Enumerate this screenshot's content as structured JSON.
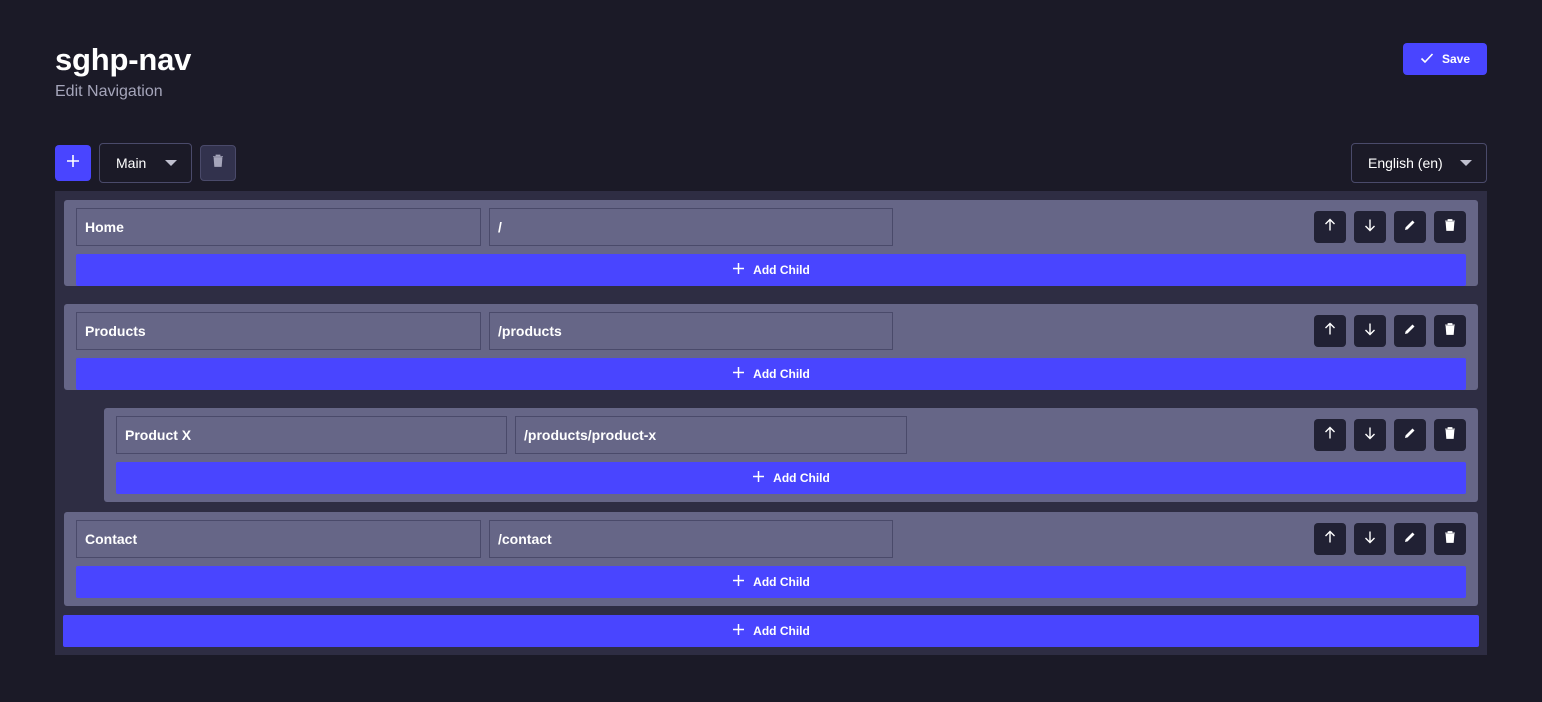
{
  "header": {
    "title": "sghp-nav",
    "subtitle": "Edit Navigation",
    "save_label": "Save"
  },
  "toolbar": {
    "menu_select_value": "Main",
    "language_select_value": "English (en)"
  },
  "items": [
    {
      "title": "Home",
      "path": "/",
      "add_child_label": "Add Child"
    },
    {
      "title": "Products",
      "path": "/products",
      "add_child_label": "Add Child"
    },
    {
      "title": "Product X",
      "path": "/products/product-x",
      "add_child_label": "Add Child"
    },
    {
      "title": "Contact",
      "path": "/contact",
      "add_child_label": "Add Child"
    }
  ],
  "root_add_child_label": "Add Child",
  "colors": {
    "background": "#1b1a27",
    "accent": "#4945ff",
    "item_bg": "#666687",
    "container_bg": "#2e2d43",
    "action_bg": "#212134"
  }
}
